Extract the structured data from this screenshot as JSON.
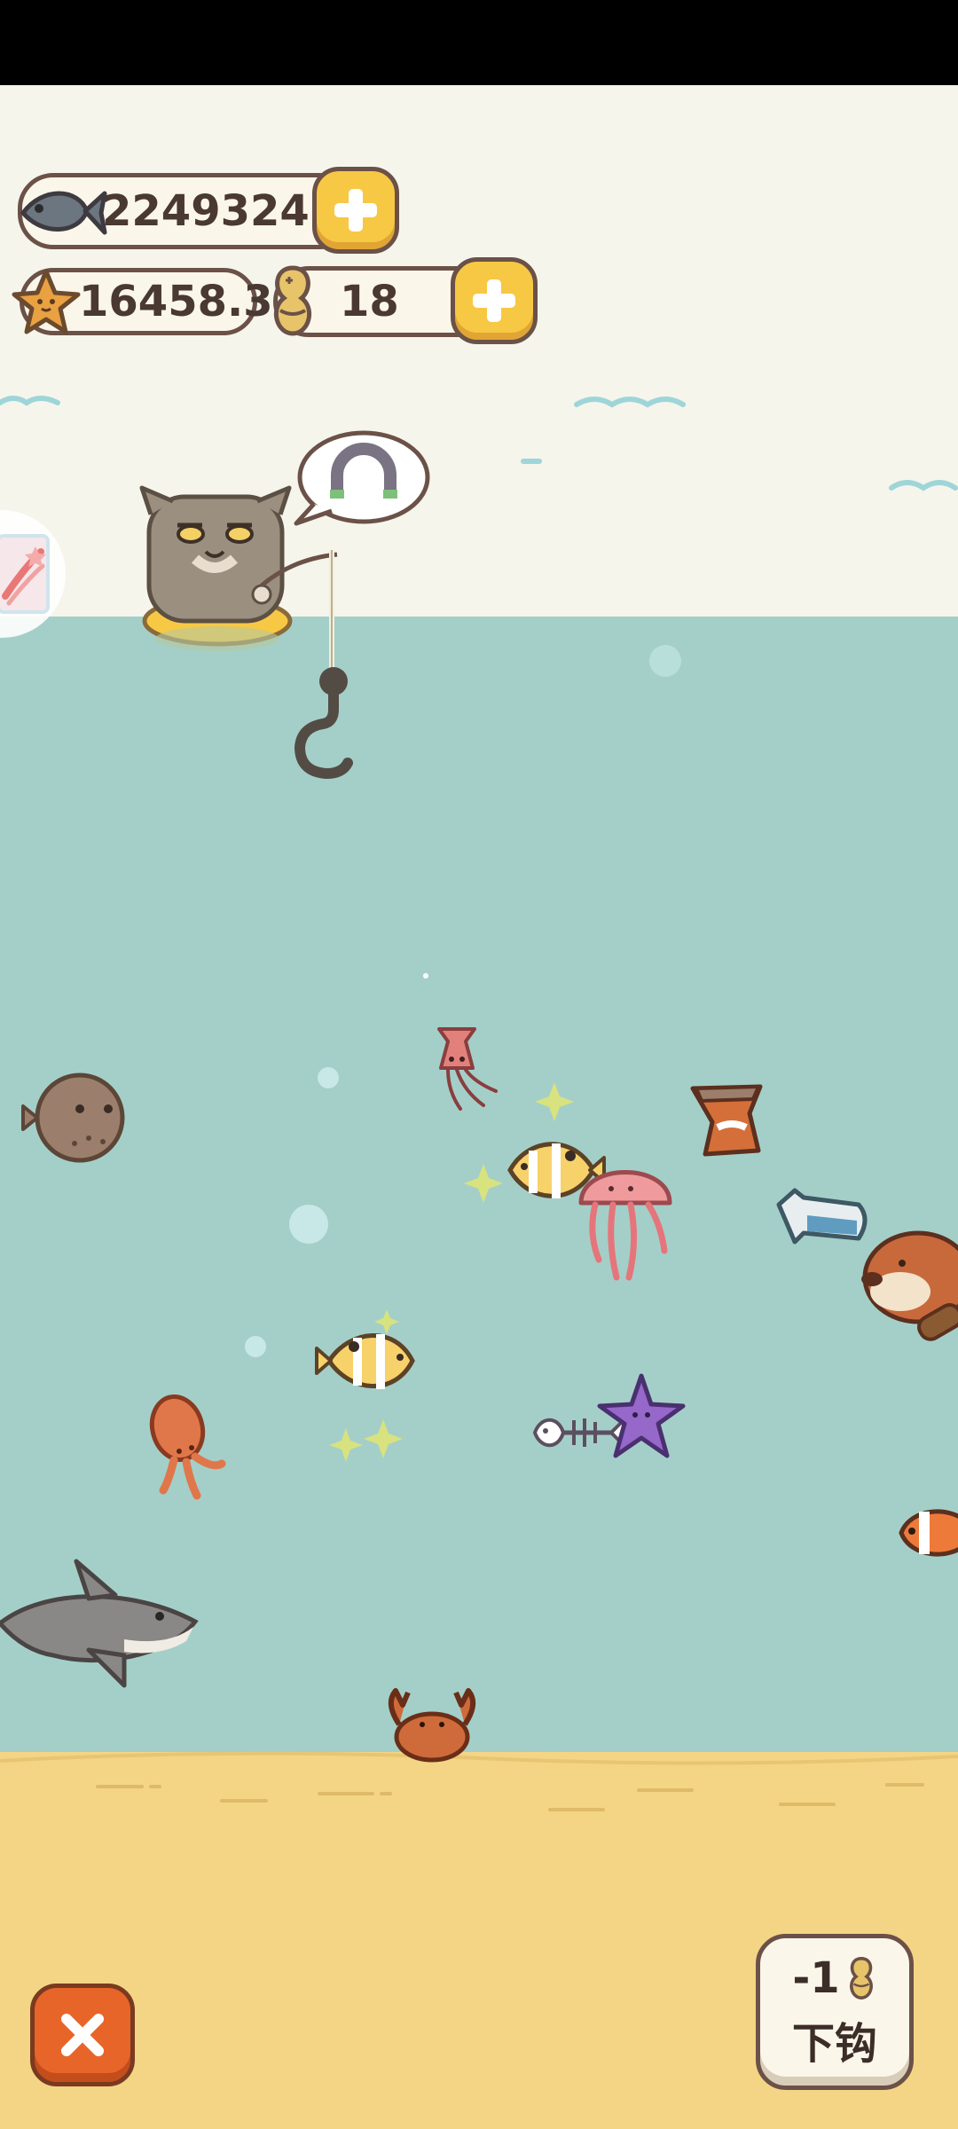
{
  "currencies": {
    "fish_count": "2249324",
    "star_count": "16458.3",
    "bait_count": "18"
  },
  "actions": {
    "cast_cost": "-1",
    "cast_label": "下钩"
  },
  "icons": {
    "fish": "fish-icon",
    "star": "starfish-icon",
    "bait": "peanut-bait-icon",
    "plus": "plus-icon",
    "close": "close-icon",
    "side": "shooting-star-icon",
    "thought": "magnet-icon"
  },
  "colors": {
    "water": "#a4cfc8",
    "sand": "#f3d585",
    "sky": "#f5f5ec",
    "button_yellow": "#f7c844",
    "close_orange": "#e8652a",
    "border_brown": "#6b5147"
  }
}
